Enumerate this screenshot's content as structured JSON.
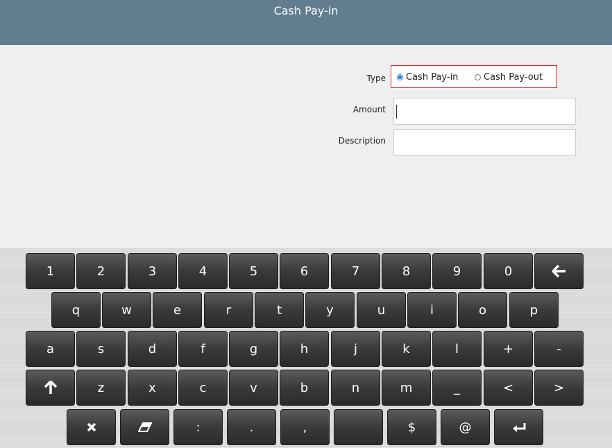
{
  "header": {
    "title": "Cash Pay-in"
  },
  "form": {
    "type_label": "Type",
    "type_options": [
      {
        "label": "Cash Pay-in",
        "selected": true
      },
      {
        "label": "Cash Pay-out",
        "selected": false
      }
    ],
    "amount_label": "Amount",
    "amount_value": "",
    "description_label": "Description",
    "description_value": ""
  },
  "keyboard": {
    "row1": [
      "1",
      "2",
      "3",
      "4",
      "5",
      "6",
      "7",
      "8",
      "9",
      "0"
    ],
    "row2": [
      "q",
      "w",
      "e",
      "r",
      "t",
      "y",
      "u",
      "i",
      "o",
      "p"
    ],
    "row3": [
      "a",
      "s",
      "d",
      "f",
      "g",
      "h",
      "j",
      "k",
      "l",
      "+",
      "-"
    ],
    "row4": [
      "z",
      "x",
      "c",
      "v",
      "b",
      "n",
      "m",
      "_",
      "<",
      ">"
    ],
    "row5": [
      ":",
      ".",
      ",",
      "$",
      "@"
    ],
    "icons": {
      "backspace": "arrow-left-icon",
      "shift": "arrow-up-icon",
      "clear": "x-icon",
      "erase": "eraser-icon",
      "enter": "enter-icon"
    },
    "accent_color": "#627d8f",
    "highlight_color": "#e0222a"
  }
}
